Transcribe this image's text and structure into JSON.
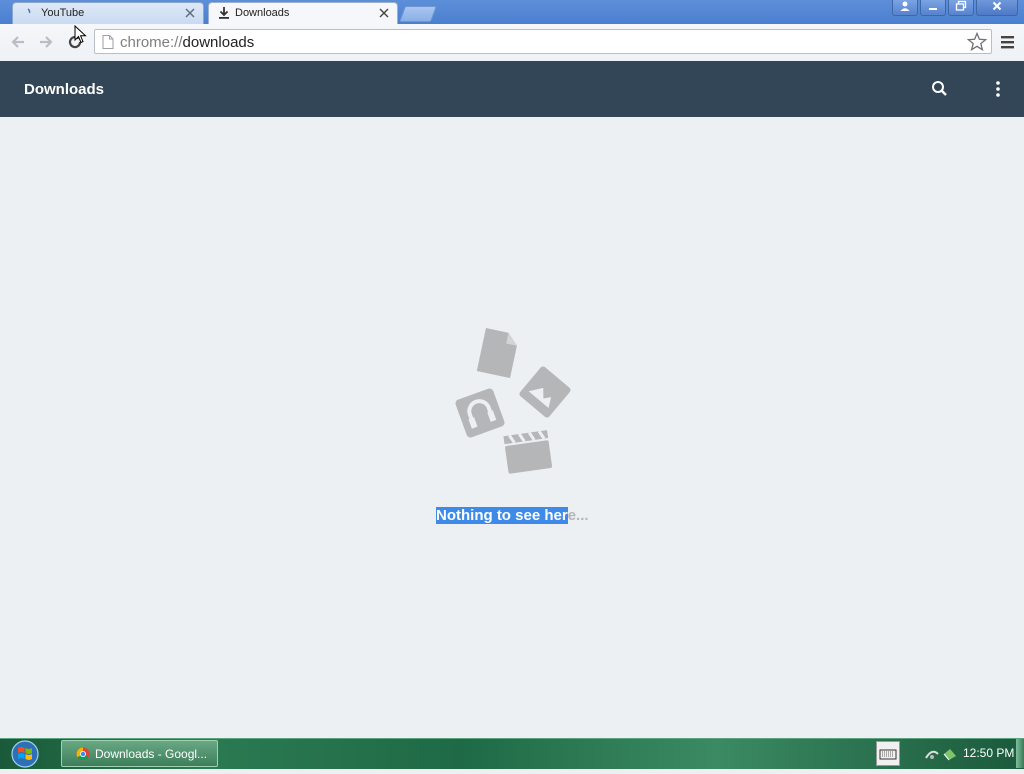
{
  "browser": {
    "tabs": [
      {
        "title": "YouTube",
        "favicon": "youtube-loading-icon",
        "active": false
      },
      {
        "title": "Downloads",
        "favicon": "download-icon",
        "active": true
      }
    ],
    "caption_buttons": [
      "profile-icon",
      "minimize-icon",
      "restore-icon",
      "close-icon"
    ],
    "address": {
      "scheme": "chrome://",
      "path": "downloads"
    },
    "toolbar_icons": [
      "back-arrow-icon",
      "forward-arrow-icon",
      "reload-icon",
      "page-icon",
      "star-icon",
      "menu-icon"
    ]
  },
  "downloads_page": {
    "title": "Downloads",
    "header_icons": [
      "search-icon",
      "more-vert-icon"
    ],
    "empty_state": {
      "selected_text": "Nothing to see her",
      "rest_text": "e...",
      "illustration_icons": [
        "document-icon",
        "image-icon",
        "audio-icon",
        "video-icon"
      ]
    }
  },
  "taskbar": {
    "start": "windows-start-icon",
    "window_button_label": "Downloads - Googl...",
    "tray_icons": [
      "keyboard-icon",
      "network-icon",
      "volume-icon"
    ],
    "clock": "12:50 PM"
  },
  "colors": {
    "header_bg": "#334658",
    "page_bg": "#edf0f2",
    "selection": "#3d8ae8",
    "taskbar": "#2b7a52"
  }
}
